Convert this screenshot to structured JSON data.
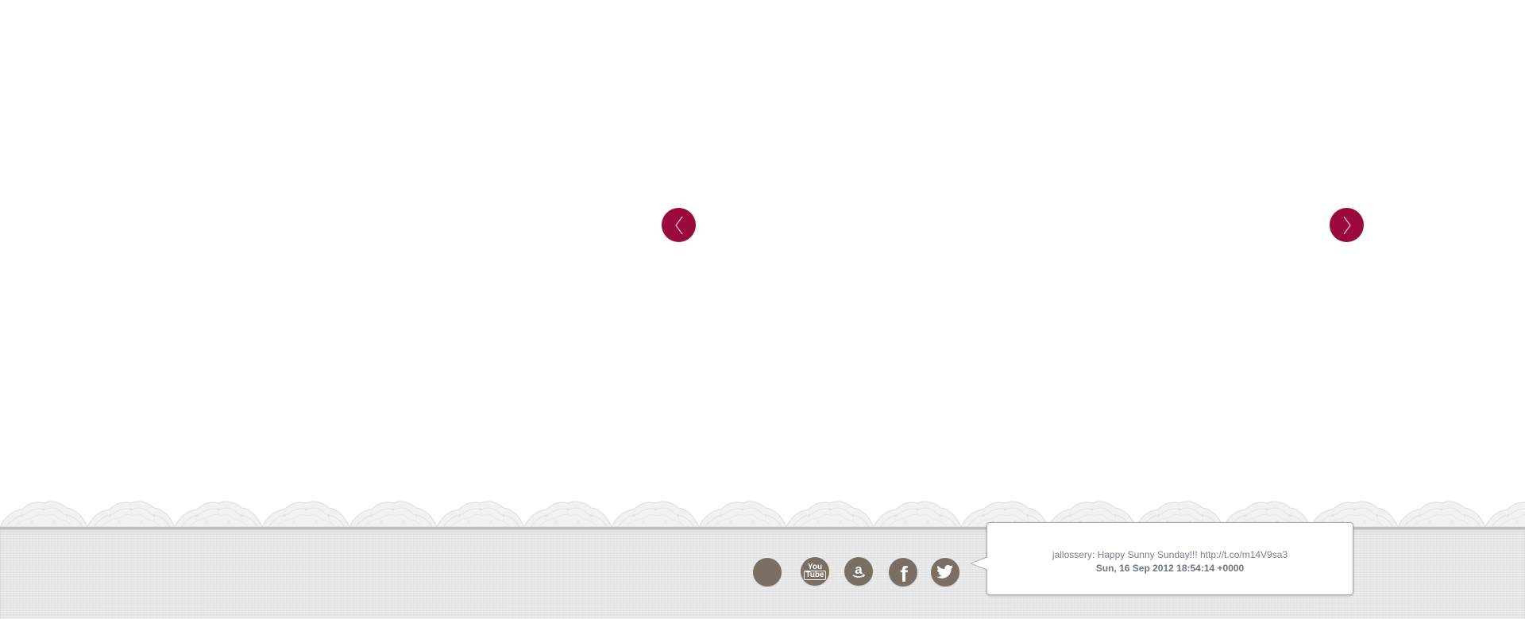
{
  "slider": {
    "prev_icon": "chevron-left-icon",
    "next_icon": "chevron-right-icon",
    "arrow_color": "#9b0a3d"
  },
  "footer": {
    "background_color": "#e5e5e5",
    "social_icon_color": "#7a6f62",
    "social_links": [
      {
        "name": "blank",
        "icon": "circle-icon"
      },
      {
        "name": "youtube",
        "icon": "youtube-icon",
        "line1": "You",
        "line2": "Tube"
      },
      {
        "name": "amazon",
        "icon": "amazon-icon",
        "glyph": "a"
      },
      {
        "name": "facebook",
        "icon": "facebook-icon",
        "glyph": "f"
      },
      {
        "name": "twitter",
        "icon": "twitter-icon"
      }
    ]
  },
  "tweet": {
    "text": "jallossery: Happy Sunny Sunday!!! http://t.co/m14V9sa3",
    "date": "Sun, 16 Sep 2012 18:54:14 +0000"
  }
}
